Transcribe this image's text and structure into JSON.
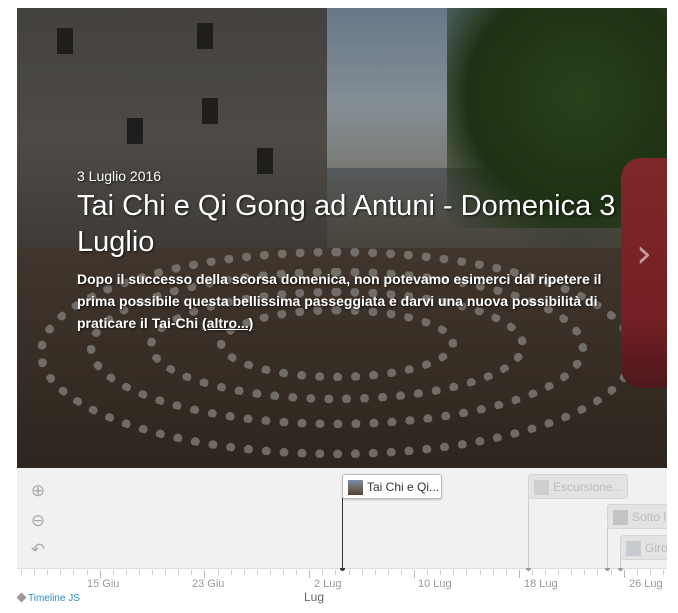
{
  "slide": {
    "date": "3 Luglio 2016",
    "title": "Tai Chi e Qi Gong ad Antuni - Domenica 3 Luglio",
    "text": "Dopo il successo della scorsa domenica, non potevamo esimerci dal ripetere il prima possibile questa bellissima passeggiata e darvi una nuova possibilità di praticare il Tai-Chi",
    "more_link": "(altro...)"
  },
  "navigation": {
    "next_icon": "chevron-right-icon"
  },
  "timenav": {
    "zoom_in_icon": "zoom-in-icon",
    "zoom_out_icon": "zoom-out-icon",
    "back_icon": "back-arrow-icon",
    "markers": [
      {
        "label": "Tai Chi e Qi...",
        "active": true
      },
      {
        "label": "Escursione...",
        "active": false
      },
      {
        "label": "Sotto l",
        "active": false
      },
      {
        "label": "Giro",
        "active": false
      }
    ]
  },
  "axis": {
    "labels": [
      "15 Giu",
      "23 Giu",
      "2 Lug",
      "10 Lug",
      "18 Lug",
      "26 Lug"
    ],
    "month": "Lug"
  },
  "credit": "Timeline JS",
  "colors": {
    "credit": "#2a8ec4",
    "active_marker_line": "#333333"
  }
}
